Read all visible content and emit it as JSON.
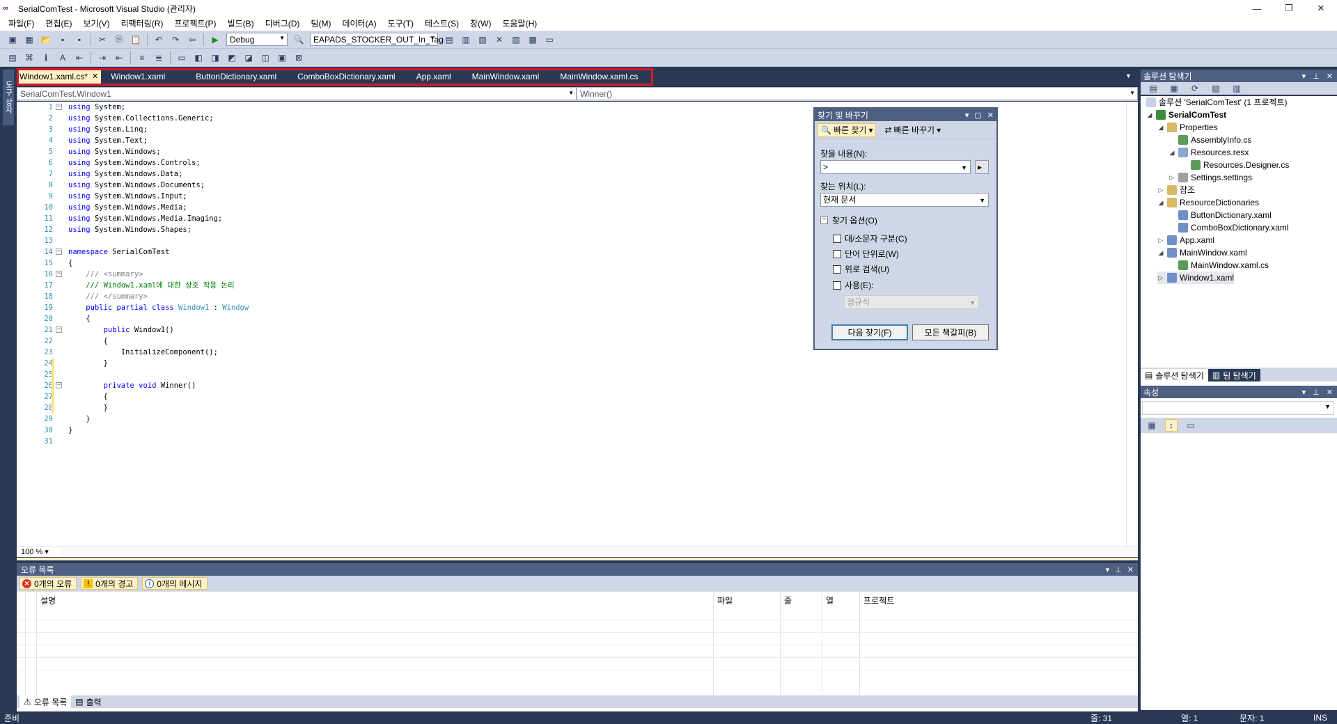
{
  "window": {
    "title": "SerialComTest - Microsoft Visual Studio (관리자)",
    "logo": "∞",
    "minimize": "—",
    "restore": "❐",
    "close": "✕"
  },
  "menu": [
    "파일(F)",
    "편집(E)",
    "보기(V)",
    "리팩터링(R)",
    "프로젝트(P)",
    "빌드(B)",
    "디버그(D)",
    "팀(M)",
    "데이터(A)",
    "도구(T)",
    "테스트(S)",
    "창(W)",
    "도움말(H)"
  ],
  "toolbar": {
    "config": "Debug",
    "find_combo": "EAPADS_STOCKER_OUT_In_Tag"
  },
  "left_tab": "도구 상자",
  "tabs": [
    {
      "label": "Window1.xaml.cs*",
      "active": true
    },
    {
      "label": "Window1.xaml"
    },
    {
      "label": "ButtonDictionary.xaml"
    },
    {
      "label": "ComboBoxDictionary.xaml"
    },
    {
      "label": "App.xaml"
    },
    {
      "label": "MainWindow.xaml"
    },
    {
      "label": "MainWindow.xaml.cs"
    }
  ],
  "tab_close": "✕",
  "nav": {
    "type": "SerialComTest.Window1",
    "member": "Winner()"
  },
  "code": [
    {
      "n": "1",
      "t": "using System;",
      "k": "using",
      "rest": " System;",
      "fold": "⊟"
    },
    {
      "n": "2",
      "k": "using",
      "rest": " System.Collections.Generic;"
    },
    {
      "n": "3",
      "k": "using",
      "rest": " System.Linq;"
    },
    {
      "n": "4",
      "k": "using",
      "rest": " System.Text;"
    },
    {
      "n": "5",
      "k": "using",
      "rest": " System.Windows;"
    },
    {
      "n": "6",
      "k": "using",
      "rest": " System.Windows.Controls;"
    },
    {
      "n": "7",
      "k": "using",
      "rest": " System.Windows.Data;"
    },
    {
      "n": "8",
      "k": "using",
      "rest": " System.Windows.Documents;"
    },
    {
      "n": "9",
      "k": "using",
      "rest": " System.Windows.Input;"
    },
    {
      "n": "10",
      "k": "using",
      "rest": " System.Windows.Media;"
    },
    {
      "n": "11",
      "k": "using",
      "rest": " System.Windows.Media.Imaging;"
    },
    {
      "n": "12",
      "k": "using",
      "rest": " System.Windows.Shapes;"
    },
    {
      "n": "13"
    },
    {
      "n": "14",
      "k": "namespace",
      "rest": " SerialComTest",
      "fold": "⊟"
    },
    {
      "n": "15",
      "rest": "{"
    },
    {
      "n": "16",
      "gr": "    /// <summary>",
      "fold": "⊟"
    },
    {
      "n": "17",
      "cm": "    /// Window1.xaml에 대한 상호 작용 논리"
    },
    {
      "n": "18",
      "gr": "    /// </summary>"
    },
    {
      "n": "19",
      "k": "    public partial class",
      "ty": " Window1",
      "rest": " : ",
      "ty2": "Window"
    },
    {
      "n": "20",
      "rest": "    {"
    },
    {
      "n": "21",
      "k": "        public",
      "rest": " Window1()",
      "fold": "⊟"
    },
    {
      "n": "22",
      "rest": "        {"
    },
    {
      "n": "23",
      "rest": "            InitializeComponent();"
    },
    {
      "n": "24",
      "rest": "        }",
      "chg": true
    },
    {
      "n": "25",
      "chg": true
    },
    {
      "n": "26",
      "k": "        private void",
      "rest": " Winner()",
      "fold": "⊟",
      "chg": true
    },
    {
      "n": "27",
      "rest": "        {",
      "chg": true
    },
    {
      "n": "28",
      "rest": "        }",
      "chg": true
    },
    {
      "n": "29",
      "rest": "    }"
    },
    {
      "n": "30",
      "rest": "}"
    },
    {
      "n": "31"
    }
  ],
  "zoom": "100 %",
  "find": {
    "title": "찾기 및 바꾸기",
    "quick_find": "빠른 찾기",
    "quick_replace": "빠른 바꾸기",
    "find_what_label": "찾을 내용(N):",
    "find_what": ">",
    "look_in_label": "찾는 위치(L):",
    "look_in": "현재 문서",
    "options_label": "찾기 옵션(O)",
    "match_case": "대/소문자 구분(C)",
    "whole_word": "단어 단위로(W)",
    "search_up": "위로 검색(U)",
    "use": "사용(E):",
    "regex": "정규식",
    "find_next": "다음 찾기(F)",
    "bookmark_all": "모든 책갈피(B)"
  },
  "errors": {
    "title": "오류 목록",
    "errors_btn": "0개의 오류",
    "warnings_btn": "0개의 경고",
    "messages_btn": "0개의 메시지",
    "col_desc": "설명",
    "col_file": "파일",
    "col_line": "줄",
    "col_col": "열",
    "col_project": "프로젝트",
    "tab_errors": "오류 목록",
    "tab_output": "출력"
  },
  "solution_explorer": {
    "title": "솔루션 탐색기",
    "solution": "솔루션 'SerialComTest' (1 프로젝트)",
    "project": "SerialComTest",
    "properties": "Properties",
    "assemblyinfo": "AssemblyInfo.cs",
    "resources": "Resources.resx",
    "resources_designer": "Resources.Designer.cs",
    "settings": "Settings.settings",
    "references": "참조",
    "resdicts": "ResourceDictionaries",
    "buttondict": "ButtonDictionary.xaml",
    "comboboxdict": "ComboBoxDictionary.xaml",
    "app": "App.xaml",
    "mainwindow": "MainWindow.xaml",
    "mainwindow_cs": "MainWindow.xaml.cs",
    "window1": "Window1.xaml",
    "tab_solution": "솔루션 탐색기",
    "tab_team": "팀 탐색기"
  },
  "properties_panel": {
    "title": "속성"
  },
  "status": {
    "ready": "준비",
    "line": "줄: 31",
    "col": "열: 1",
    "ch": "문자: 1",
    "ins": "INS"
  },
  "colors": {
    "frame": "#293955",
    "header": "#4d6082",
    "tab_active": "#fff2c6",
    "highlight": "#e0151f"
  }
}
